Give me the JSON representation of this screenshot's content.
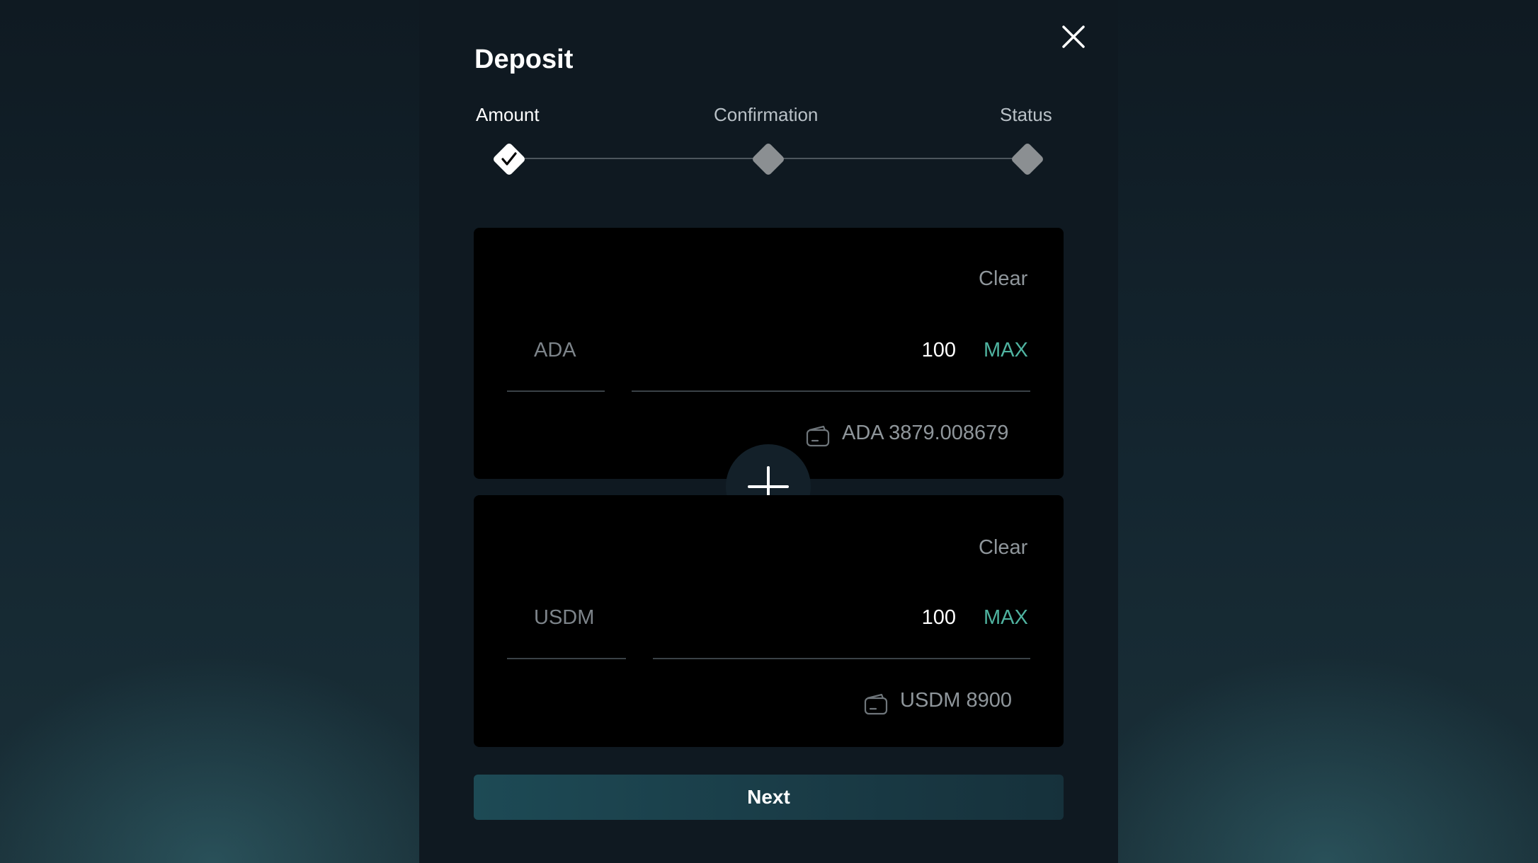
{
  "dialog": {
    "title": "Deposit",
    "close_icon": "close-icon"
  },
  "stepper": {
    "steps": [
      {
        "label": "Amount",
        "state": "completed"
      },
      {
        "label": "Confirmation",
        "state": "pending"
      },
      {
        "label": "Status",
        "state": "pending"
      }
    ]
  },
  "inputs": [
    {
      "token": "ADA",
      "value": "100",
      "clear_label": "Clear",
      "max_label": "MAX",
      "balance": "ADA 3879.008679",
      "balance_icon": "wallet-icon"
    },
    {
      "token": "USDM",
      "value": "100",
      "clear_label": "Clear",
      "max_label": "MAX",
      "balance": "USDM 8900",
      "balance_icon": "wallet-icon"
    }
  ],
  "add_icon": "plus-icon",
  "next_label": "Next",
  "colors": {
    "accent": "#4fb3a0",
    "button": "#1d4a55",
    "panel": "#000000",
    "dialog": "#0f1921"
  }
}
